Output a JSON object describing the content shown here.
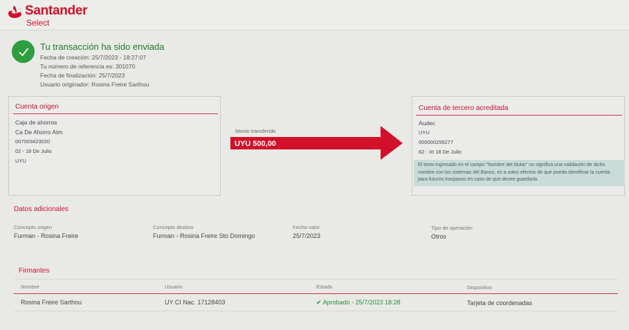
{
  "brand": {
    "name": "Santander",
    "sub": "Select"
  },
  "success": {
    "title": "Tu transacción ha sido enviada",
    "creation": "Fecha de creación: 25/7/2023 - 18:27:07",
    "reference": "Tu número de referencia es: 301070",
    "finalization": "Fecha de finalización: 25/7/2023",
    "user": "Usuario originador: Rosina Freire Sarthou"
  },
  "origin": {
    "title": "Cuenta origen",
    "lines": [
      "Caja de ahorros",
      "Ca De Ahorro Atm",
      "007003423020",
      "02 - 18 De Julio",
      "UYU"
    ]
  },
  "transfer": {
    "label": "Monto transferido",
    "amount": "UYU  500,00"
  },
  "dest": {
    "title": "Cuenta de tercero acreditada",
    "lines": [
      "Audec",
      "UYU",
      "000000256277",
      "62 - Xt 18 De Julio"
    ],
    "note": "El texto ingresado en el campo \"Nombre del titular\" no significa una validación de dicho nombre con los sistemas del Banco, es a solos efectos de que pueda identificar la cuenta para futuros traspasos en caso de que desee guardarla."
  },
  "additional": {
    "title": "Datos adicionales",
    "fields": [
      {
        "label": "Concepto origen",
        "value": "Furman - Rosina Freire"
      },
      {
        "label": "Concepto destino",
        "value": "Furman - Rosina Freire Sto Domingo"
      },
      {
        "label": "Fecha valor",
        "value": "25/7/2023"
      },
      {
        "label": "Tipo de operación",
        "value": "Otros"
      }
    ]
  },
  "signers": {
    "title": "Firmantes",
    "headers": [
      "Nombre",
      "Usuario",
      "Estado",
      "Dispositivo"
    ],
    "row": [
      "Rosina Freire Sarthou",
      "UY CI Nac. 17128403",
      "Aprobado - 25/7/2023 18:28",
      "Tarjeta de coordenadas"
    ]
  },
  "colors": {
    "accent": "#c8102e",
    "success": "#2e9e3e"
  }
}
